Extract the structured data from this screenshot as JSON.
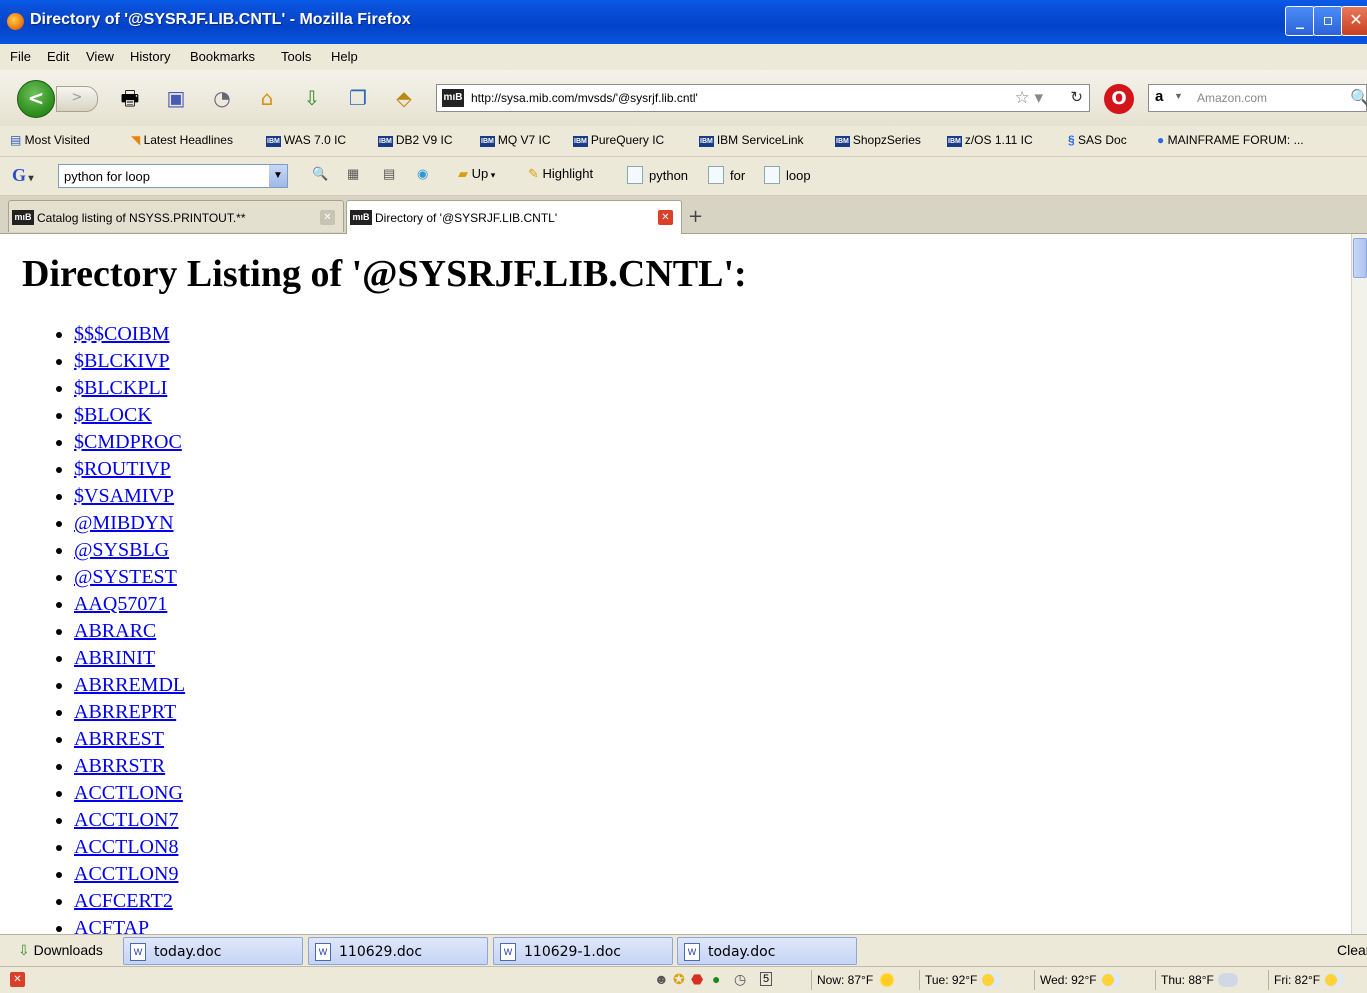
{
  "window": {
    "title": "Directory of '@SYSRJF.LIB.CNTL' - Mozilla Firefox",
    "minimize": "_",
    "restore": "▫",
    "close": "✕"
  },
  "menu": [
    "File",
    "Edit",
    "View",
    "History",
    "Bookmarks",
    "Tools",
    "Help"
  ],
  "navbar": {
    "url": "http://sysa.mib.com/mvsds/'@sysrjf.lib.cntl'",
    "site_badge": "mıB",
    "search_engine": "a",
    "search_placeholder": "Amazon.com"
  },
  "bookmarks": [
    {
      "label": "Most Visited",
      "icon": "page-icon"
    },
    {
      "label": "Latest Headlines",
      "icon": "rss-icon"
    },
    {
      "label": "WAS 7.0 IC",
      "icon": "ibm-icon"
    },
    {
      "label": "DB2 V9 IC",
      "icon": "ibm-icon"
    },
    {
      "label": "MQ V7 IC",
      "icon": "ibm-icon"
    },
    {
      "label": "PureQuery IC",
      "icon": "ibm-icon"
    },
    {
      "label": "IBM ServiceLink",
      "icon": "ibm-icon"
    },
    {
      "label": "ShopzSeries",
      "icon": "ibm-icon"
    },
    {
      "label": "z/OS 1.11 IC",
      "icon": "ibm-icon"
    },
    {
      "label": "SAS Doc",
      "icon": "sas-icon"
    },
    {
      "label": "MAINFRAME FORUM: ...",
      "icon": "info-icon"
    }
  ],
  "google_toolbar": {
    "logo": "G",
    "query": "python for loop",
    "up_label": "Up",
    "highlight_label": "Highlight",
    "terms": [
      "python",
      "for",
      "loop"
    ]
  },
  "tabs": [
    {
      "label": "Catalog listing of NSYSS.PRINTOUT.**",
      "active": false
    },
    {
      "label": "Directory of '@SYSRJF.LIB.CNTL'",
      "active": true
    }
  ],
  "page": {
    "heading": "Directory Listing of '@SYSRJF.LIB.CNTL':",
    "members": [
      "$$$COIBM",
      "$BLCKIVP",
      "$BLCKPLI",
      "$BLOCK",
      "$CMDPROC",
      "$ROUTIVP",
      "$VSAMIVP",
      "@MIBDYN",
      "@SYSBLG",
      "@SYSTEST",
      "AAQ57071",
      "ABRARC",
      "ABRINIT",
      "ABRREMDL",
      "ABRREPRT",
      "ABRREST",
      "ABRRSTR",
      "ACCTLONG",
      "ACCTLON7",
      "ACCTLON8",
      "ACCTLON9",
      "ACFCERT2",
      "ACFTAP"
    ]
  },
  "downloads_bar": {
    "label": "Downloads",
    "items": [
      "today.doc",
      "110629.doc",
      "110629-1.doc",
      "today.doc"
    ],
    "clear_label": "Clear"
  },
  "status_bar": {
    "weather": [
      {
        "label": "Now: 87°F",
        "icon": "sun-icon"
      },
      {
        "label": "Tue: 92°F",
        "icon": "partly-cloudy-icon"
      },
      {
        "label": "Wed: 92°F",
        "icon": "partly-cloudy-icon"
      },
      {
        "label": "Thu: 88°F",
        "icon": "cloudy-icon"
      },
      {
        "label": "Fri: 82°F",
        "icon": "partly-cloudy-icon"
      }
    ],
    "calendar_day": "5"
  }
}
